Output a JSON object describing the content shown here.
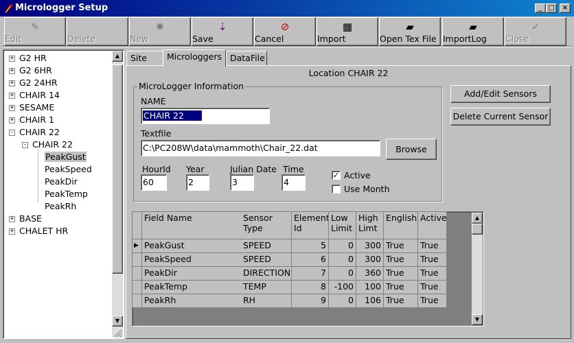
{
  "window": {
    "title": "Micrologger Setup",
    "controls": {
      "minimize": "_",
      "maximize": "□",
      "close": "×"
    }
  },
  "toolbar": {
    "buttons": [
      {
        "label": "Edit",
        "icon": "edit-icon",
        "glyph": "✎",
        "enabled": false
      },
      {
        "label": "Delete",
        "icon": "delete-icon",
        "glyph": "",
        "enabled": false
      },
      {
        "label": "New",
        "icon": "new-icon",
        "glyph": "✹",
        "enabled": false
      },
      {
        "label": "Save",
        "icon": "save-icon",
        "glyph": "⇣",
        "enabled": true
      },
      {
        "label": "Cancel",
        "icon": "cancel-icon",
        "glyph": "⊘",
        "enabled": true
      },
      {
        "label": "Import",
        "icon": "import-icon",
        "glyph": "▦",
        "enabled": true
      },
      {
        "label": "Open Tex File",
        "icon": "folder-open-icon",
        "glyph": "▰",
        "enabled": true
      },
      {
        "label": "ImportLog",
        "icon": "import-log-icon",
        "glyph": "▰",
        "enabled": true
      },
      {
        "label": "Close",
        "icon": "checkmark-icon",
        "glyph": "✓",
        "enabled": false
      }
    ]
  },
  "tree": {
    "items": [
      {
        "label": "G2 HR",
        "level": 0,
        "expander": "+"
      },
      {
        "label": "G2 6HR",
        "level": 0,
        "expander": "+"
      },
      {
        "label": "G2 24HR",
        "level": 0,
        "expander": "+"
      },
      {
        "label": "CHAIR 14",
        "level": 0,
        "expander": "+"
      },
      {
        "label": "SESAME",
        "level": 0,
        "expander": "+"
      },
      {
        "label": "CHAIR 1",
        "level": 0,
        "expander": "+"
      },
      {
        "label": "CHAIR 22",
        "level": 0,
        "expander": "-"
      },
      {
        "label": "CHAIR 22",
        "level": 1,
        "expander": "-"
      },
      {
        "label": "PeakGust",
        "level": 2,
        "expander": "",
        "selected": true
      },
      {
        "label": "PeakSpeed",
        "level": 2,
        "expander": ""
      },
      {
        "label": "PeakDir",
        "level": 2,
        "expander": ""
      },
      {
        "label": "PeakTemp",
        "level": 2,
        "expander": ""
      },
      {
        "label": "PeakRh",
        "level": 2,
        "expander": ""
      },
      {
        "label": "BASE",
        "level": 0,
        "expander": "+"
      },
      {
        "label": "CHALET HR",
        "level": 0,
        "expander": "+"
      }
    ]
  },
  "tabs": [
    {
      "label": "Site",
      "active": false
    },
    {
      "label": "Microloggers",
      "active": true
    },
    {
      "label": "DataFile",
      "active": false
    }
  ],
  "location_label": "Location CHAIR 22",
  "micrologger": {
    "group_title": "MicroLogger Information",
    "name_label": "NAME",
    "name_value": "CHAIR 22",
    "textfile_label": "Textfile",
    "textfile_value": "C:\\PC208W\\data\\mammoth\\Chair_22.dat",
    "browse_label": "Browse",
    "hourid_label": "HourId",
    "hourid_value": "60",
    "year_label": "Year",
    "year_value": "2",
    "julian_label": "Julian Date",
    "julian_value": "3",
    "time_label": "Time",
    "time_value": "4",
    "active_label": "Active",
    "active_checked": true,
    "use_month_label": "Use Month",
    "use_month_checked": false
  },
  "buttons": {
    "add_edit_sensors": "Add/Edit Sensors",
    "delete_current_sensor": "Delete Current Sensor"
  },
  "grid": {
    "columns": [
      "Field Name",
      "Sensor Type",
      "Element Id",
      "Low Limit",
      "High Limt",
      "English",
      "Active"
    ],
    "rows": [
      [
        "PeakGust",
        "SPEED",
        "5",
        "0",
        "300",
        "True",
        "True"
      ],
      [
        "PeakSpeed",
        "SPEED",
        "6",
        "0",
        "300",
        "True",
        "True"
      ],
      [
        "PeakDir",
        "DIRECTION",
        "7",
        "0",
        "360",
        "True",
        "True"
      ],
      [
        "PeakTemp",
        "TEMP",
        "8",
        "-100",
        "100",
        "True",
        "True"
      ],
      [
        "PeakRh",
        "RH",
        "9",
        "0",
        "106",
        "True",
        "True"
      ]
    ],
    "current_row_marker": "▶"
  }
}
